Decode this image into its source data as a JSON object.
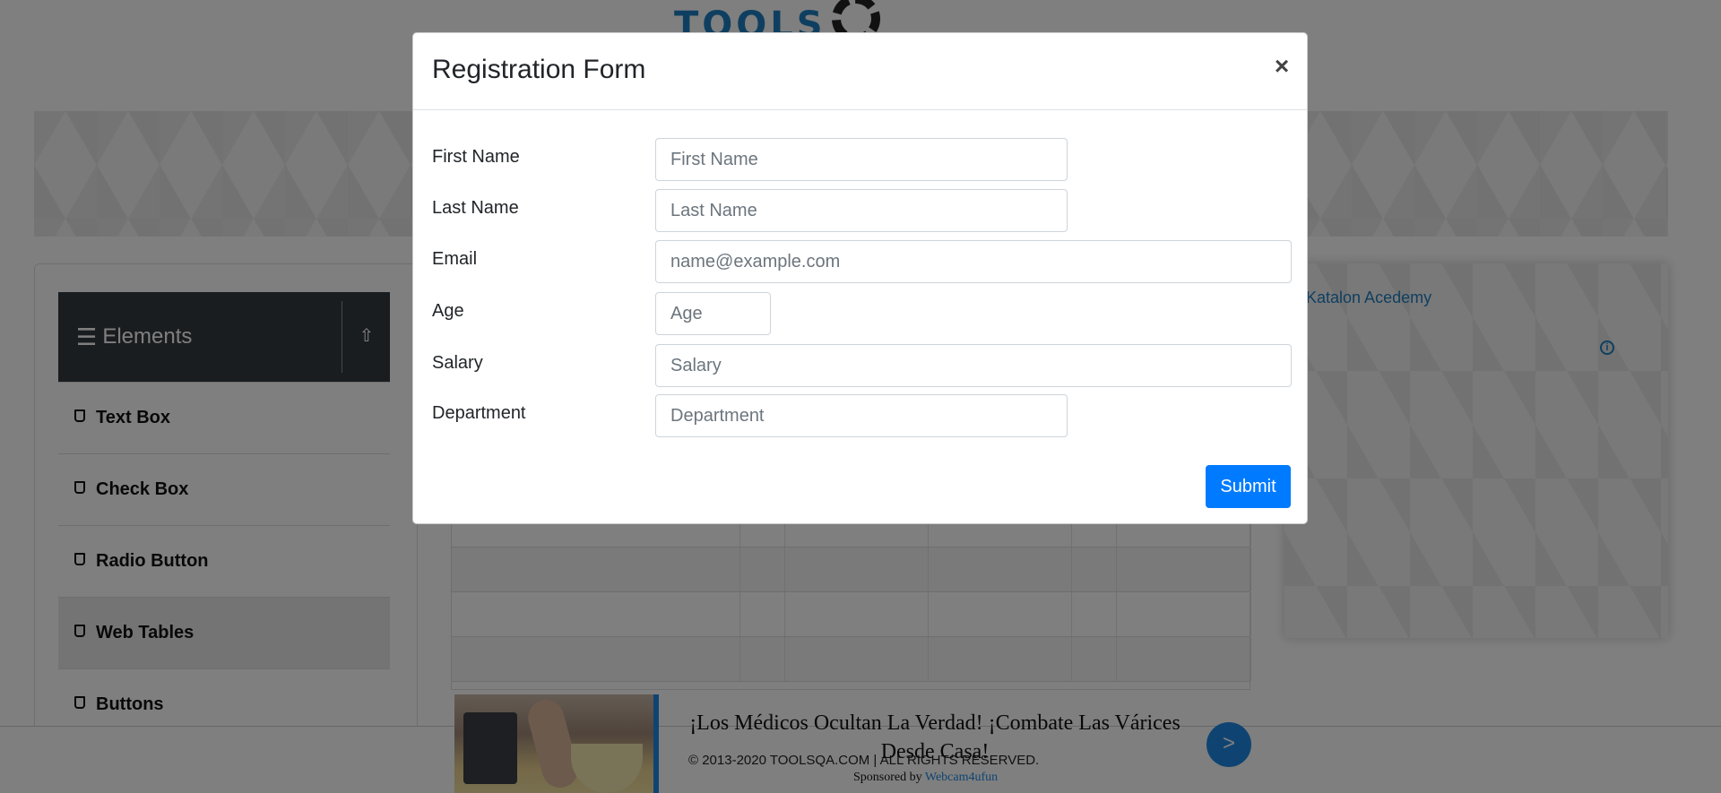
{
  "site": {
    "logo_text": "TOOLS"
  },
  "sidebar": {
    "group_title": "Elements",
    "items": [
      {
        "label": "Text Box"
      },
      {
        "label": "Check Box"
      },
      {
        "label": "Radio Button"
      },
      {
        "label": "Web Tables"
      },
      {
        "label": "Buttons"
      }
    ]
  },
  "right_ad": {
    "alt_text": "Katalon Acedemy",
    "info_symbol": "i"
  },
  "bottom_ad": {
    "headline": "¡Los Médicos Ocultan La Verdad! ¡Combate Las Várices Desde Casa!",
    "sponsored_prefix": "Sponsored by",
    "sponsor_name": "Webcam4ufun",
    "go_label": ">"
  },
  "footer": {
    "copyright": "© 2013-2020 TOOLSQA.COM | ALL RIGHTS RESERVED."
  },
  "modal": {
    "title": "Registration Form",
    "close_label": "×",
    "fields": {
      "first_name": {
        "label": "First Name",
        "placeholder": "First Name",
        "value": ""
      },
      "last_name": {
        "label": "Last Name",
        "placeholder": "Last Name",
        "value": ""
      },
      "email": {
        "label": "Email",
        "placeholder": "name@example.com",
        "value": ""
      },
      "age": {
        "label": "Age",
        "placeholder": "Age",
        "value": ""
      },
      "salary": {
        "label": "Salary",
        "placeholder": "Salary",
        "value": ""
      },
      "department": {
        "label": "Department",
        "placeholder": "Department",
        "value": ""
      }
    },
    "submit_label": "Submit"
  },
  "colors": {
    "primary": "#007bff",
    "sidebar_header": "#343a40",
    "backdrop": "rgba(0,0,0,0.5)"
  }
}
